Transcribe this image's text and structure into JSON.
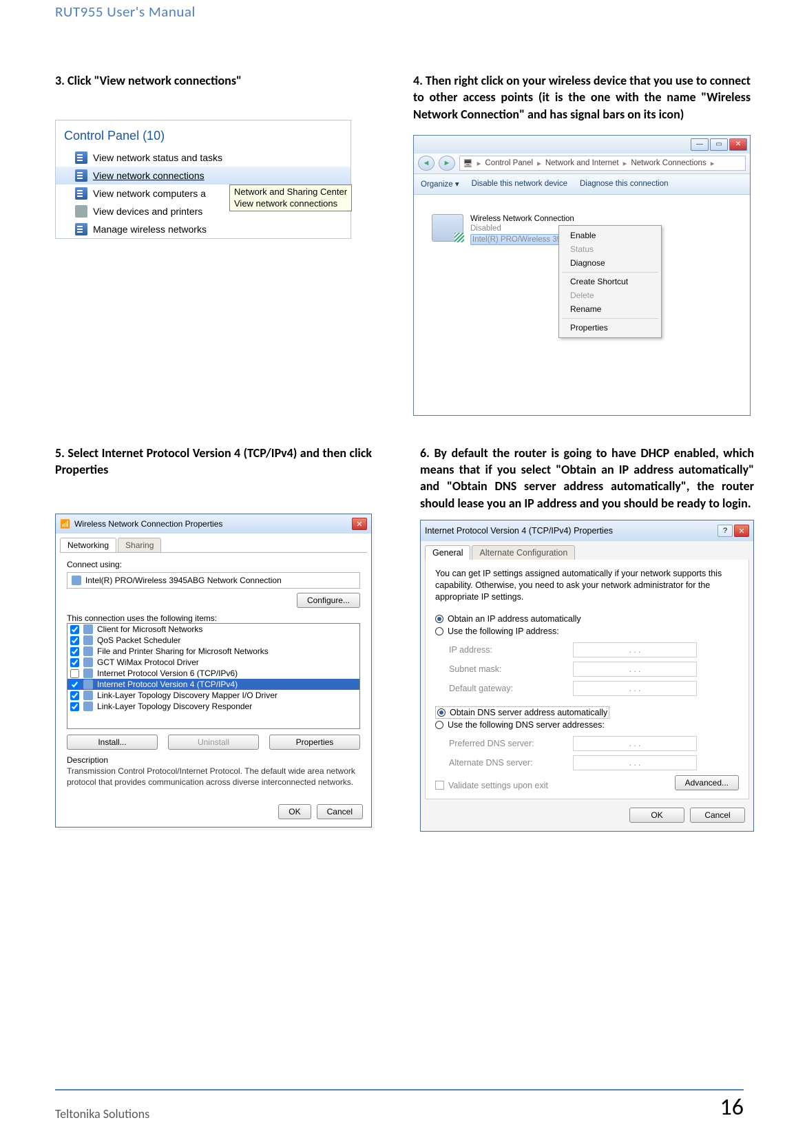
{
  "header": "RUT955 User's Manual",
  "footer": {
    "left": "Teltonika Solutions",
    "page": "16"
  },
  "step3": {
    "text": "3. Click \"View network connections\"",
    "panel_header": "Control Panel (10)",
    "items": [
      "View network status and tasks",
      "View network connections",
      "View network computers a",
      "View devices and printers",
      "Manage wireless networks"
    ],
    "tooltip_line1": "Network and Sharing Center",
    "tooltip_line2": "View network connections"
  },
  "step4": {
    "text": "4. Then right click on your wireless device that you use to connect to other access points (it is the one with the name \"Wireless Network Connection\" and has signal bars on its icon)",
    "nav": {
      "p1": "Control Panel",
      "p2": "Network and Internet",
      "p3": "Network Connections"
    },
    "toolbar": {
      "organize": "Organize ▾",
      "disable": "Disable this network device",
      "diagnose": "Diagnose this connection"
    },
    "adapter": {
      "name": "Wireless Network Connection",
      "status": "Disabled",
      "hw": "Intel(R) PRO/Wireless 3945…"
    },
    "menu": {
      "enable": "Enable",
      "status": "Status",
      "diagnose": "Diagnose",
      "create_shortcut": "Create Shortcut",
      "delete": "Delete",
      "rename": "Rename",
      "properties": "Properties"
    }
  },
  "step5": {
    "text": "5. Select Internet Protocol Version 4 (TCP/IPv4) and then click Properties",
    "title": "Wireless Network Connection Properties",
    "tab_networking": "Networking",
    "tab_sharing": "Sharing",
    "connect_using_lbl": "Connect using:",
    "adapter": "Intel(R) PRO/Wireless 3945ABG Network Connection",
    "configure_btn": "Configure...",
    "uses_lbl": "This connection uses the following items:",
    "items": [
      "Client for Microsoft Networks",
      "QoS Packet Scheduler",
      "File and Printer Sharing for Microsoft Networks",
      "GCT WiMax Protocol Driver",
      "Internet Protocol Version 6 (TCP/IPv6)",
      "Internet Protocol Version 4 (TCP/IPv4)",
      "Link-Layer Topology Discovery Mapper I/O Driver",
      "Link-Layer Topology Discovery Responder"
    ],
    "install_btn": "Install...",
    "uninstall_btn": "Uninstall",
    "properties_btn": "Properties",
    "desc_lbl": "Description",
    "desc_text": "Transmission Control Protocol/Internet Protocol. The default wide area network protocol that provides communication across diverse interconnected networks.",
    "ok": "OK",
    "cancel": "Cancel"
  },
  "step6": {
    "text": "6. By default the router is going to have DHCP enabled, which means that if you select \"Obtain an IP address automatically\" and \"Obtain DNS server address automatically\", the router should lease you an IP address and you should be ready to login.",
    "title": "Internet Protocol Version 4 (TCP/IPv4) Properties",
    "tab_general": "General",
    "tab_alt": "Alternate Configuration",
    "intro": "You can get IP settings assigned automatically if your network supports this capability. Otherwise, you need to ask your network administrator for the appropriate IP settings.",
    "r_obtain_ip": "Obtain an IP address automatically",
    "r_use_ip": "Use the following IP address:",
    "lbl_ip": "IP address:",
    "lbl_mask": "Subnet mask:",
    "lbl_gw": "Default gateway:",
    "r_obtain_dns": "Obtain DNS server address automatically",
    "r_use_dns": "Use the following DNS server addresses:",
    "lbl_pdns": "Preferred DNS server:",
    "lbl_adns": "Alternate DNS server:",
    "validate": "Validate settings upon exit",
    "advanced": "Advanced...",
    "ok": "OK",
    "cancel": "Cancel",
    "ip_placeholder": ".       .       ."
  }
}
